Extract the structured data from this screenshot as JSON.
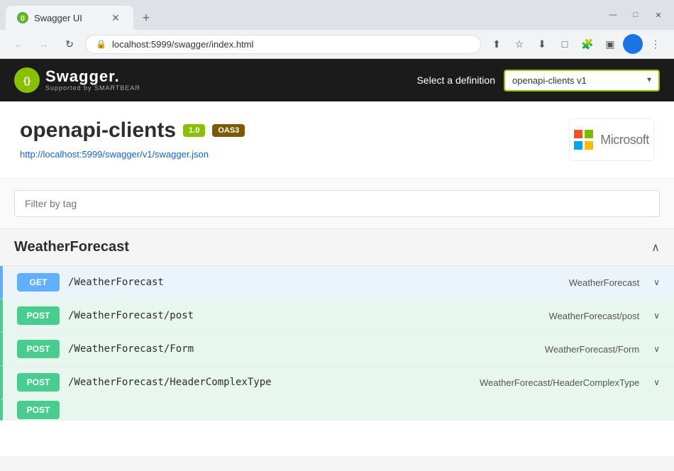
{
  "browser": {
    "tab_title": "Swagger UI",
    "tab_new_label": "+",
    "address": "localhost:5999/swagger/index.html",
    "window_controls": {
      "minimize": "—",
      "maximize": "□",
      "close": "✕"
    },
    "back_btn": "←",
    "forward_btn": "→",
    "refresh_btn": "↻",
    "nav_menu": "⋮"
  },
  "header": {
    "logo_icon": "{ }",
    "logo_main": "Swagger.",
    "logo_sub": "Supported by SMARTBEAR",
    "definition_label": "Select a definition",
    "definition_value": "openapi-clients v1",
    "definition_options": [
      "openapi-clients v1"
    ]
  },
  "info": {
    "title": "openapi-clients",
    "version_badge": "1.0",
    "oas_badge": "OAS3",
    "link": "http://localhost:5999/swagger/v1/swagger.json",
    "ms_logo_text": "Microsoft"
  },
  "filter": {
    "placeholder": "Filter by tag"
  },
  "sections": [
    {
      "name": "WeatherForecast",
      "collapsed": false,
      "endpoints": [
        {
          "method": "GET",
          "path": "/WeatherForecast",
          "summary": "WeatherForecast"
        },
        {
          "method": "POST",
          "path": "/WeatherForecast/post",
          "summary": "WeatherForecast/post"
        },
        {
          "method": "POST",
          "path": "/WeatherForecast/Form",
          "summary": "WeatherForecast/Form"
        },
        {
          "method": "POST",
          "path": "/WeatherForecast/HeaderComplexType",
          "summary": "WeatherForecast/HeaderComplexType"
        }
      ]
    }
  ],
  "colors": {
    "swagger_bg": "#1b1b1b",
    "swagger_green": "#89bf04",
    "get_color": "#61affe",
    "post_color": "#49cc90",
    "get_bg": "#ebf3fb",
    "post_bg": "#e8f6f0"
  }
}
